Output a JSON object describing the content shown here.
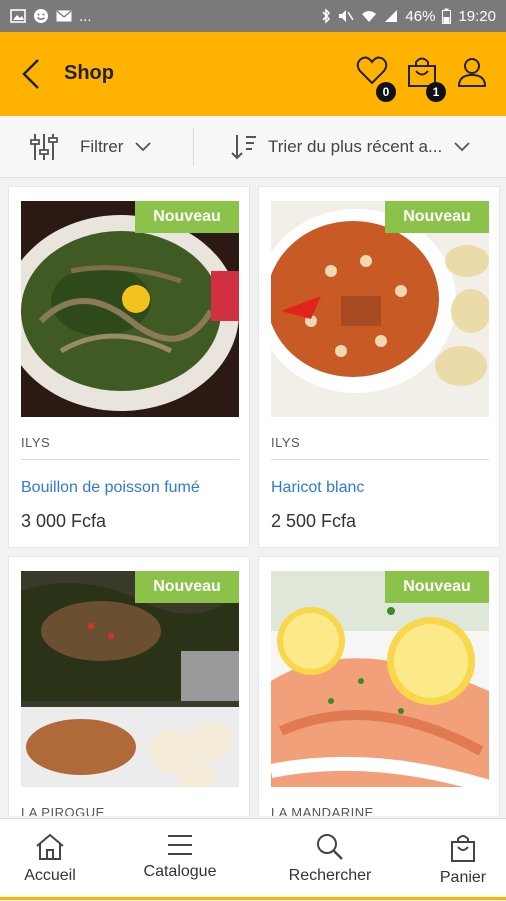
{
  "status_bar": {
    "battery": "46%",
    "time": "19:20",
    "more": "..."
  },
  "app_bar": {
    "title": "Shop",
    "wishlist_count": "0",
    "cart_count": "1",
    "accent_color": "#ffb300"
  },
  "filters": {
    "filter_label": "Filtrer",
    "sort_label": "Trier du plus récent a..."
  },
  "products": [
    {
      "tag": "Nouveau",
      "vendor": "ILYS",
      "name": "Bouillon de poisson fumé",
      "price": "3 000 Fcfa"
    },
    {
      "tag": "Nouveau",
      "vendor": "ILYS",
      "name": "Haricot blanc",
      "price": "2 500 Fcfa"
    },
    {
      "tag": "Nouveau",
      "vendor": "LA PIROGUE",
      "name": "",
      "price": ""
    },
    {
      "tag": "Nouveau",
      "vendor": "LA MANDARINE",
      "name": "",
      "price": ""
    }
  ],
  "bottom_nav": {
    "items": [
      {
        "label": "Accueil",
        "icon": "home-icon"
      },
      {
        "label": "Catalogue",
        "icon": "menu-icon"
      },
      {
        "label": "Rechercher",
        "icon": "search-icon"
      },
      {
        "label": "Panier",
        "icon": "bag-icon"
      }
    ]
  }
}
